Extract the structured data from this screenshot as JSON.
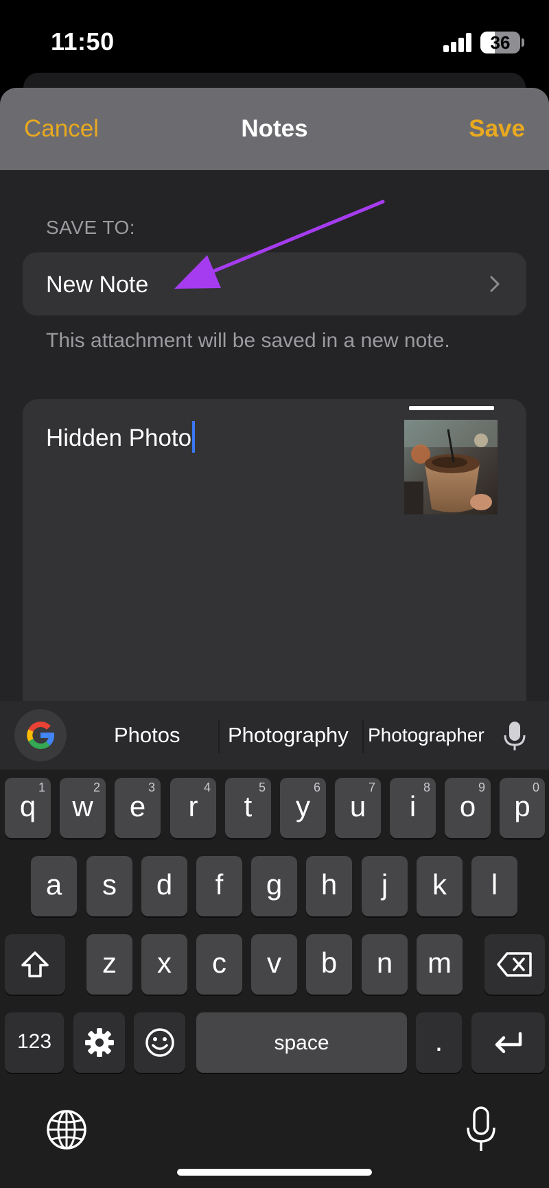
{
  "status_bar": {
    "time": "11:50",
    "battery": "36"
  },
  "nav": {
    "cancel_label": "Cancel",
    "title": "Notes",
    "save_label": "Save"
  },
  "save_to": {
    "label": "SAVE TO:",
    "destination": "New Note",
    "hint": "This attachment will be saved in a new note."
  },
  "note": {
    "text": "Hidden Photo"
  },
  "keyboard": {
    "suggestions": [
      "Photos",
      "Photography",
      "Photographer"
    ],
    "row1": [
      {
        "key": "q",
        "num": "1"
      },
      {
        "key": "w",
        "num": "2"
      },
      {
        "key": "e",
        "num": "3"
      },
      {
        "key": "r",
        "num": "4"
      },
      {
        "key": "t",
        "num": "5"
      },
      {
        "key": "y",
        "num": "6"
      },
      {
        "key": "u",
        "num": "7"
      },
      {
        "key": "i",
        "num": "8"
      },
      {
        "key": "o",
        "num": "9"
      },
      {
        "key": "p",
        "num": "0"
      }
    ],
    "row2": [
      "a",
      "s",
      "d",
      "f",
      "g",
      "h",
      "j",
      "k",
      "l"
    ],
    "row3": [
      "z",
      "x",
      "c",
      "v",
      "b",
      "n",
      "m"
    ],
    "numbers_label": "123",
    "space_label": "space",
    "period_label": "."
  },
  "colors": {
    "accent": "#e9a91f",
    "annotation_arrow": "#a63cf0",
    "cursor": "#3a78f2"
  }
}
